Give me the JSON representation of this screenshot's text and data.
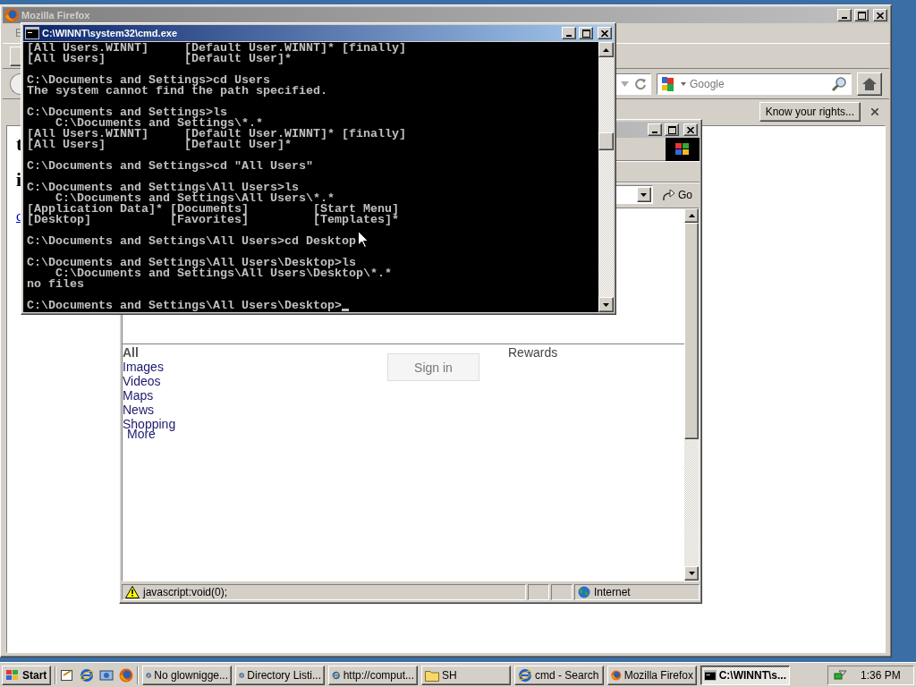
{
  "firefox_window": {
    "title": "Mozilla Firefox",
    "active": false,
    "menu_bar": {
      "partial_item": "E"
    },
    "search_field": {
      "placeholder": "Google"
    },
    "notification_bar": {
      "button": "Know your rights..."
    },
    "page_fragments": [
      {
        "kind": "heading",
        "text": "t"
      },
      {
        "kind": "heading",
        "text": "i"
      },
      {
        "kind": "link",
        "text": "c"
      }
    ]
  },
  "ie_window": {
    "active": false,
    "address_bar": {
      "go_button": "Go"
    },
    "nav_links": [
      {
        "label": "All",
        "selected": true
      },
      {
        "label": "Images",
        "selected": false
      },
      {
        "label": "Videos",
        "selected": false
      },
      {
        "label": "Maps",
        "selected": false
      },
      {
        "label": "News",
        "selected": false
      },
      {
        "label": "Shopping",
        "selected": false
      }
    ],
    "more_link": "More",
    "sign_in_button": "Sign in",
    "rewards_link": "Rewards",
    "status_bar": {
      "text": "javascript:void(0);",
      "zone": "Internet"
    }
  },
  "cmd_window": {
    "title": "C:\\WINNT\\system32\\cmd.exe",
    "active": true,
    "output_blocks": [
      [
        "[All Users.WINNT]     [Default User.WINNT]* [finally]",
        "[All Users]           [Default User]*"
      ],
      [
        "C:\\Documents and Settings>cd Users",
        "The system cannot find the path specified."
      ],
      [
        "C:\\Documents and Settings>ls",
        "    C:\\Documents and Settings\\*.*",
        "[All Users.WINNT]     [Default User.WINNT]* [finally]",
        "[All Users]           [Default User]*"
      ],
      [
        "C:\\Documents and Settings>cd \"All Users\""
      ],
      [
        "C:\\Documents and Settings\\All Users>ls",
        "    C:\\Documents and Settings\\All Users\\*.*",
        "[Application Data]* [Documents]         [Start Menu]",
        "[Desktop]           [Favorites]         [Templates]*"
      ],
      [
        "C:\\Documents and Settings\\All Users>cd Desktop"
      ],
      [
        "C:\\Documents and Settings\\All Users\\Desktop>ls",
        "    C:\\Documents and Settings\\All Users\\Desktop\\*.*",
        "no files"
      ]
    ],
    "prompt": "C:\\Documents and Settings\\All Users\\Desktop>"
  },
  "taskbar": {
    "start_button": "Start",
    "tasks": [
      {
        "label": "No glownigge...",
        "kind": "ie",
        "selected": false
      },
      {
        "label": "Directory Listi...",
        "kind": "ie",
        "selected": false
      },
      {
        "label": "http://comput...",
        "kind": "ie",
        "selected": false
      },
      {
        "label": "SH",
        "kind": "folder",
        "selected": false
      },
      {
        "label": "cmd - Search",
        "kind": "ie",
        "selected": false
      },
      {
        "label": "Mozilla Firefox",
        "kind": "firefox",
        "selected": false
      },
      {
        "label": "C:\\WINNT\\s...",
        "kind": "cmd",
        "selected": true
      }
    ],
    "clock": "1:36 PM"
  }
}
